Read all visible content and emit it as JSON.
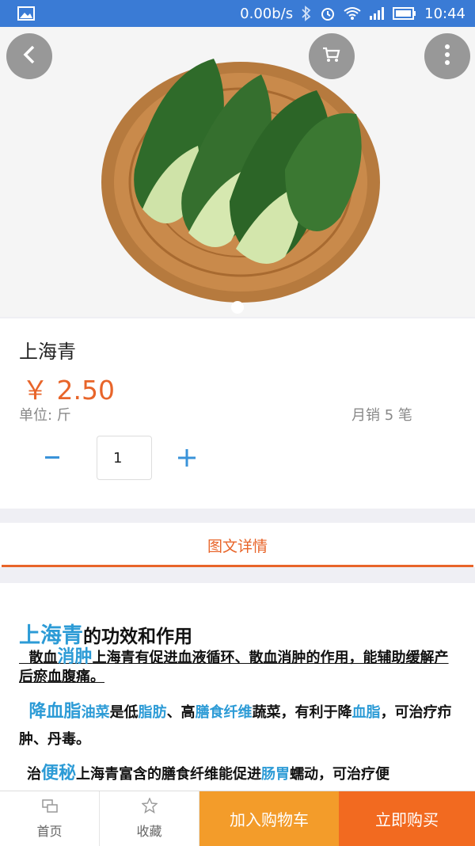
{
  "statusbar": {
    "network_speed": "0.00b/s",
    "time": "10:44"
  },
  "product": {
    "name": "上海青",
    "price": "￥ 2.50",
    "unit": "单位:  斤",
    "sales": "月销 5 笔",
    "quantity": "1"
  },
  "tabs": {
    "detail_label": "图文详情"
  },
  "detail": {
    "title_highlight": "上海青",
    "title_rest": "的功效和作用",
    "p1_lead": "散血",
    "p1_highlight": "消肿",
    "p1_text": "上海青有促进血液循环、散血消肿的作用，能辅助缓解产后瘀血腹痛。",
    "p2_highlight": "降血脂",
    "p2_hl2": "油菜",
    "p2_t1": "是低",
    "p2_hl3": "脂肪",
    "p2_t2": "、高",
    "p2_hl4": "膳食纤维",
    "p2_t3": "蔬菜，有利于降",
    "p2_hl5": "血脂",
    "p2_t4": "，可治疗疖肿、丹毒。",
    "p3_lead": "治",
    "p3_highlight": "便秘",
    "p3_t1": "上海青富含的膳食纤维能促进",
    "p3_hl2": "肠胃",
    "p3_t2": "蠕动，可治疗便"
  },
  "bottom": {
    "home_label": "首页",
    "favorite_label": "收藏",
    "add_cart_label": "加入购物车",
    "buy_label": "立即购买"
  },
  "colors": {
    "accent": "#e8652a",
    "highlight": "#2c9bd6",
    "statusbar": "#3a7bd5",
    "cart": "#f39c2a",
    "buy": "#f26a20"
  },
  "icons": [
    "gallery-icon",
    "bluetooth-icon",
    "alarm-icon",
    "wifi-icon",
    "signal-icon",
    "battery-icon",
    "back-icon",
    "cart-icon",
    "more-icon",
    "home-icon",
    "star-icon"
  ]
}
